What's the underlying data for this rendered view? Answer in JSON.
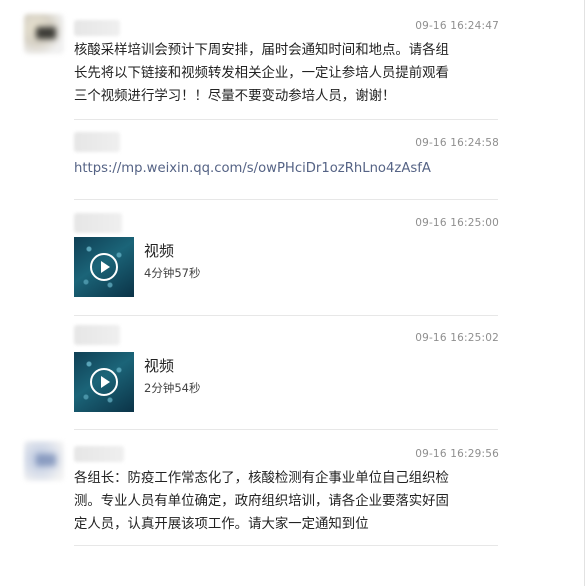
{
  "messages": [
    {
      "time": "09-16 16:24:47",
      "lines": [
        "核酸采样培训会预计下周安排，届时会通知时间和地点。请各组",
        "长先将以下链接和视频转发相关企业，一定让参培人员提前观看",
        "三个视频进行学习！！尽量不要变动参培人员，谢谢！"
      ]
    },
    {
      "time": "09-16 16:24:58",
      "link": "https://mp.weixin.qq.com/s/owPHciDr1ozRhLno4zAsfA"
    },
    {
      "time": "09-16 16:25:00",
      "video": {
        "title": "视频",
        "duration": "4分钟57秒"
      }
    },
    {
      "time": "09-16 16:25:02",
      "video": {
        "title": "视频",
        "duration": "2分钟54秒"
      }
    },
    {
      "time": "09-16 16:29:56",
      "lines": [
        "各组长：防疫工作常态化了，核酸检测有企事业单位自己组织检",
        "测。专业人员有单位确定，政府组织培训，请各企业要落实好固",
        "定人员，认真开展该项工作。请大家一定通知到位"
      ]
    }
  ],
  "colors": {
    "link": "#556385",
    "timestamp": "#8f8f8f",
    "divider": "#e7e7e7"
  },
  "icons": [
    "play-icon"
  ]
}
